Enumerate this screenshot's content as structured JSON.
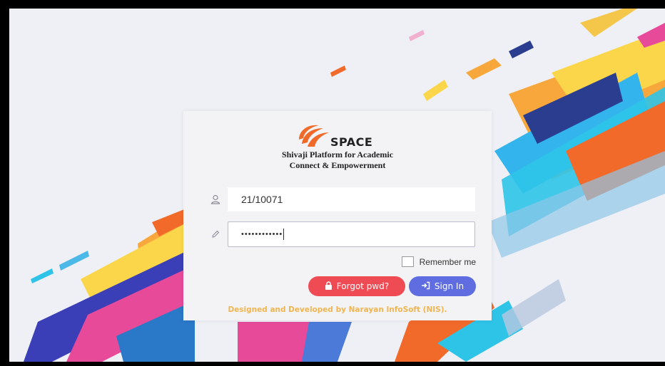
{
  "app": {
    "brand": "SPACE",
    "tagline_line1": "Shivaji Platform for Academic",
    "tagline_line2": "Connect & Empowerment"
  },
  "login": {
    "username_value": "21/10071",
    "password_mask": "••••••••••••",
    "remember_label": "Remember me",
    "forgot_label": "Forgot pwd?",
    "signin_label": "Sign In"
  },
  "footer": {
    "credit": "Designed and Developed by Narayan InfoSoft (NIS)."
  },
  "icons": {
    "user": "user-icon",
    "password": "pencil-icon",
    "lock": "lock-icon",
    "signin": "sign-in-icon"
  },
  "colors": {
    "forgot_button": "#ef4b55",
    "signin_button": "#5f6de0",
    "footer_text": "#f0b550",
    "logo_orange": "#f06a2a"
  }
}
